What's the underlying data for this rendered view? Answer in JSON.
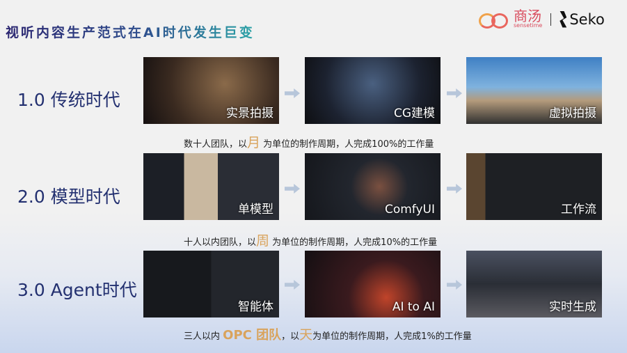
{
  "title": "视听内容生产范式在AI时代发生巨变",
  "logo": {
    "brand_cn": "商汤",
    "brand_en": "sensetime",
    "product": "Seko"
  },
  "rows": [
    {
      "era": "1.0 传统时代",
      "images": [
        "实景拍摄",
        "CG建模",
        "虚拟拍摄"
      ],
      "desc_pre": "数十人团队，以",
      "desc_hl": "月",
      "desc_post": "为单位的制作周期，人完成100%的工作量"
    },
    {
      "era": "2.0 模型时代",
      "images": [
        "单模型",
        "ComfyUI",
        "工作流"
      ],
      "desc_pre": "十人以内团队，以",
      "desc_hl": "周",
      "desc_post": "为单位的制作周期，人完成10%的工作量"
    },
    {
      "era": "3.0 Agent时代",
      "images": [
        "智能体",
        "AI to AI",
        "实时生成"
      ],
      "desc_pre": "三人以内",
      "desc_team": "OPC 团队",
      "desc_mid": "，以",
      "desc_hl": "天",
      "desc_post": "为单位的制作周期，人完成1%的工作量"
    }
  ]
}
